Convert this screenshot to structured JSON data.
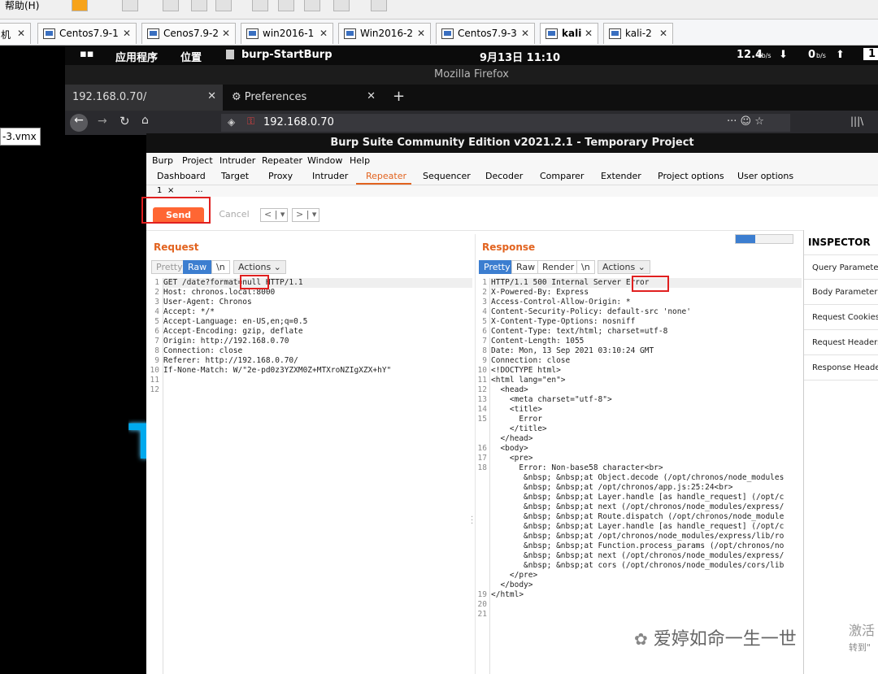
{
  "vm_toolbar": {
    "menu_help": "帮助(H)"
  },
  "vm_tabs": [
    {
      "label": "机"
    },
    {
      "label": "Centos7.9-1"
    },
    {
      "label": "Cenos7.9-2"
    },
    {
      "label": "win2016-1"
    },
    {
      "label": "Win2016-2"
    },
    {
      "label": "Centos7.9-3"
    },
    {
      "label": "kali"
    },
    {
      "label": "kali-2"
    }
  ],
  "vm_left": {
    "vmx_label": "-3.vmx",
    "wallpaper_text": "T2"
  },
  "kali_bar": {
    "apps_menu": "应用程序",
    "places_menu": "位置",
    "active_app": "burp-StartBurp",
    "clock": "9月13日  11:10",
    "net_down": "12.4",
    "net_down_unit": "kb/s",
    "net_up": "0",
    "net_up_unit": "b/s",
    "workspace": "1"
  },
  "firefox": {
    "window_title": "Mozilla Firefox",
    "tabs": [
      "192.168.0.70/",
      "Preferences"
    ],
    "url": "192.168.0.70"
  },
  "burp": {
    "window_title": "Burp Suite Community Edition v2021.2.1 - Temporary Project",
    "menu": [
      "Burp",
      "Project",
      "Intruder",
      "Repeater",
      "Window",
      "Help"
    ],
    "tabs": [
      "Dashboard",
      "Target",
      "Proxy",
      "Intruder",
      "Repeater",
      "Sequencer",
      "Decoder",
      "Comparer",
      "Extender",
      "Project options",
      "User options"
    ],
    "active_tab": "Repeater",
    "repeater_tab": "1",
    "repeater_tab_close": "×",
    "repeater_tab_more": "...",
    "send_label": "Send",
    "cancel_label": "Cancel",
    "request": {
      "title": "Request",
      "view_tabs": [
        "Pretty",
        "Raw",
        "\\n",
        "Actions"
      ],
      "lines": [
        "GET /date?format=null HTTP/1.1",
        "Host: chronos.local:8000",
        "User-Agent: Chronos",
        "Accept: */*",
        "Accept-Language: en-US,en;q=0.5",
        "Accept-Encoding: gzip, deflate",
        "Origin: http://192.168.0.70",
        "Connection: close",
        "Referer: http://192.168.0.70/",
        "If-None-Match: W/\"2e-pd0z3YZXM0Z+MTXroNZIgXZX+hY\"",
        "",
        ""
      ]
    },
    "response": {
      "title": "Response",
      "view_tabs": [
        "Pretty",
        "Raw",
        "Render",
        "\\n",
        "Actions"
      ],
      "lines": [
        "HTTP/1.1 500 Internal Server Error",
        "X-Powered-By: Express",
        "Access-Control-Allow-Origin: *",
        "Content-Security-Policy: default-src 'none'",
        "X-Content-Type-Options: nosniff",
        "Content-Type: text/html; charset=utf-8",
        "Content-Length: 1055",
        "Date: Mon, 13 Sep 2021 03:10:24 GMT",
        "Connection: close",
        "",
        "<!DOCTYPE html>",
        "<html lang=\"en\">",
        "  <head>",
        "    <meta charset=\"utf-8\">",
        "    <title>",
        "      Error",
        "    </title>",
        "  </head>",
        "  <body>",
        "    <pre>",
        "      Error: Non-base58 character<br>",
        "       &nbsp; &nbsp;at Object.decode (/opt/chronos/node_modules",
        "       &nbsp; &nbsp;at /opt/chronos/app.js:25:24<br>",
        "       &nbsp; &nbsp;at Layer.handle [as handle_request] (/opt/c",
        "       &nbsp; &nbsp;at next (/opt/chronos/node_modules/express/",
        "       &nbsp; &nbsp;at Route.dispatch (/opt/chronos/node_module",
        "       &nbsp; &nbsp;at Layer.handle [as handle_request] (/opt/c",
        "       &nbsp; &nbsp;at /opt/chronos/node_modules/express/lib/ro",
        "       &nbsp; &nbsp;at Function.process_params (/opt/chronos/no",
        "       &nbsp; &nbsp;at next (/opt/chronos/node_modules/express/",
        "       &nbsp; &nbsp;at cors (/opt/chronos/node_modules/cors/lib",
        "    </pre>",
        "  </body>",
        "</html>",
        ""
      ],
      "gutter": [
        "1",
        "2",
        "3",
        "4",
        "5",
        "6",
        "7",
        "8",
        "9",
        "10",
        "11",
        "12",
        "13",
        "14",
        "15",
        "",
        "",
        "16",
        "17",
        "18",
        "",
        "",
        "",
        "",
        "",
        "",
        "",
        "",
        "",
        "",
        "",
        "",
        "19",
        "20",
        "21"
      ]
    },
    "inspector": {
      "title": "INSPECTOR",
      "items": [
        "Query Parameters",
        "Body Parameters",
        "Request Cookies",
        "Request Headers",
        "Response Headers"
      ]
    }
  },
  "watermark": {
    "text": "爱婷如命一生一世",
    "side_top": "激活",
    "side_bottom": "转到\""
  }
}
